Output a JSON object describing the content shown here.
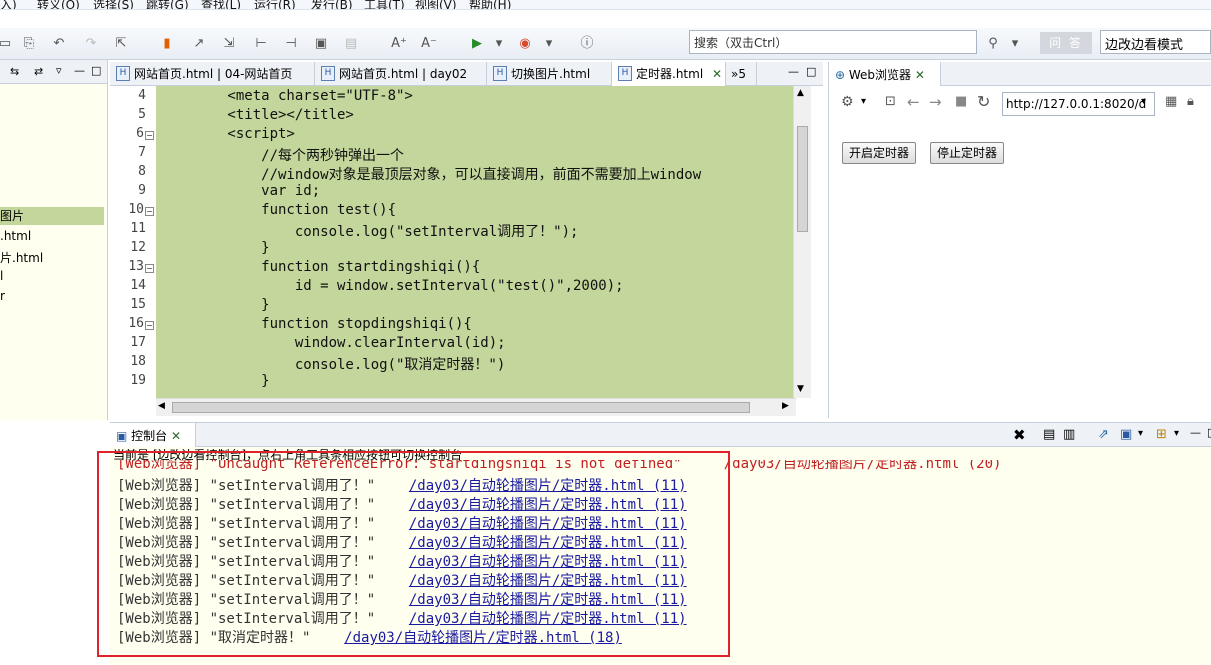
{
  "menu": [
    "入)",
    "转义(O)",
    "选择(S)",
    "跳转(G)",
    "查找(L)",
    "运行(R)",
    "发行(B)",
    "工具(T)",
    "视图(V)",
    "帮助(H)"
  ],
  "search": {
    "placeholder": "搜索（双击Ctrl）"
  },
  "qa_label": "问 答",
  "mode_label": "边改边看模式",
  "left_items": [
    "图片",
    ".html",
    "片.html",
    "l",
    "r"
  ],
  "editor_tabs": [
    {
      "label": "网站首页.html | 04-网站首页"
    },
    {
      "label": "网站首页.html | day02"
    },
    {
      "label": "切换图片.html"
    },
    {
      "label": "定时器.html"
    },
    {
      "label": "»5"
    }
  ],
  "code_lines": [
    {
      "n": "4",
      "text": "        <meta charset=\"UTF-8\">"
    },
    {
      "n": "5",
      "text": "        <title></title>"
    },
    {
      "n": "6",
      "text": "        <script>",
      "fold": true
    },
    {
      "n": "7",
      "text": "            //每个两秒钟弹出一个"
    },
    {
      "n": "8",
      "text": "            //window对象是最顶层对象，可以直接调用，前面不需要加上window"
    },
    {
      "n": "9",
      "text": "            var id;"
    },
    {
      "n": "10",
      "text": "            function test(){",
      "fold": true
    },
    {
      "n": "11",
      "text": "                console.log(\"setInterval调用了！\");"
    },
    {
      "n": "12",
      "text": "            }"
    },
    {
      "n": "13",
      "text": "            function startdingshiqi(){",
      "fold": true
    },
    {
      "n": "14",
      "text": "                id = window.setInterval(\"test()\",2000);"
    },
    {
      "n": "15",
      "text": "            }"
    },
    {
      "n": "16",
      "text": "            function stopdingshiqi(){",
      "fold": true
    },
    {
      "n": "17",
      "text": "                window.clearInterval(id);"
    },
    {
      "n": "18",
      "text": "                console.log(\"取消定时器！\")"
    },
    {
      "n": "19",
      "text": "            }"
    }
  ],
  "browser": {
    "tab_label": "Web浏览器",
    "url": "http://127.0.0.1:8020/d",
    "start_btn": "开启定时器",
    "stop_btn": "停止定时器"
  },
  "console": {
    "tab_label": "控制台",
    "info": "当前是 [边改边看控制台]，点右上角工具条相应按钮可切换控制台",
    "error_line": "[Web浏览器] \"Uncaught ReferenceError: startdingshiqi is not defined\"     /day03/自动轮播图片/定时器.html (20)",
    "rows": [
      {
        "prefix": "[Web浏览器] \"setInterval调用了！\"    ",
        "link": "/day03/自动轮播图片/定时器.html (11)"
      },
      {
        "prefix": "[Web浏览器] \"setInterval调用了！\"    ",
        "link": "/day03/自动轮播图片/定时器.html (11)"
      },
      {
        "prefix": "[Web浏览器] \"setInterval调用了！\"    ",
        "link": "/day03/自动轮播图片/定时器.html (11)"
      },
      {
        "prefix": "[Web浏览器] \"setInterval调用了！\"    ",
        "link": "/day03/自动轮播图片/定时器.html (11)"
      },
      {
        "prefix": "[Web浏览器] \"setInterval调用了！\"    ",
        "link": "/day03/自动轮播图片/定时器.html (11)"
      },
      {
        "prefix": "[Web浏览器] \"setInterval调用了！\"    ",
        "link": "/day03/自动轮播图片/定时器.html (11)"
      },
      {
        "prefix": "[Web浏览器] \"setInterval调用了！\"    ",
        "link": "/day03/自动轮播图片/定时器.html (11)"
      },
      {
        "prefix": "[Web浏览器] \"setInterval调用了！\"    ",
        "link": "/day03/自动轮播图片/定时器.html (11)"
      },
      {
        "prefix": "[Web浏览器] \"取消定时器！\"    ",
        "link": "/day03/自动轮播图片/定时器.html (18)"
      }
    ]
  }
}
